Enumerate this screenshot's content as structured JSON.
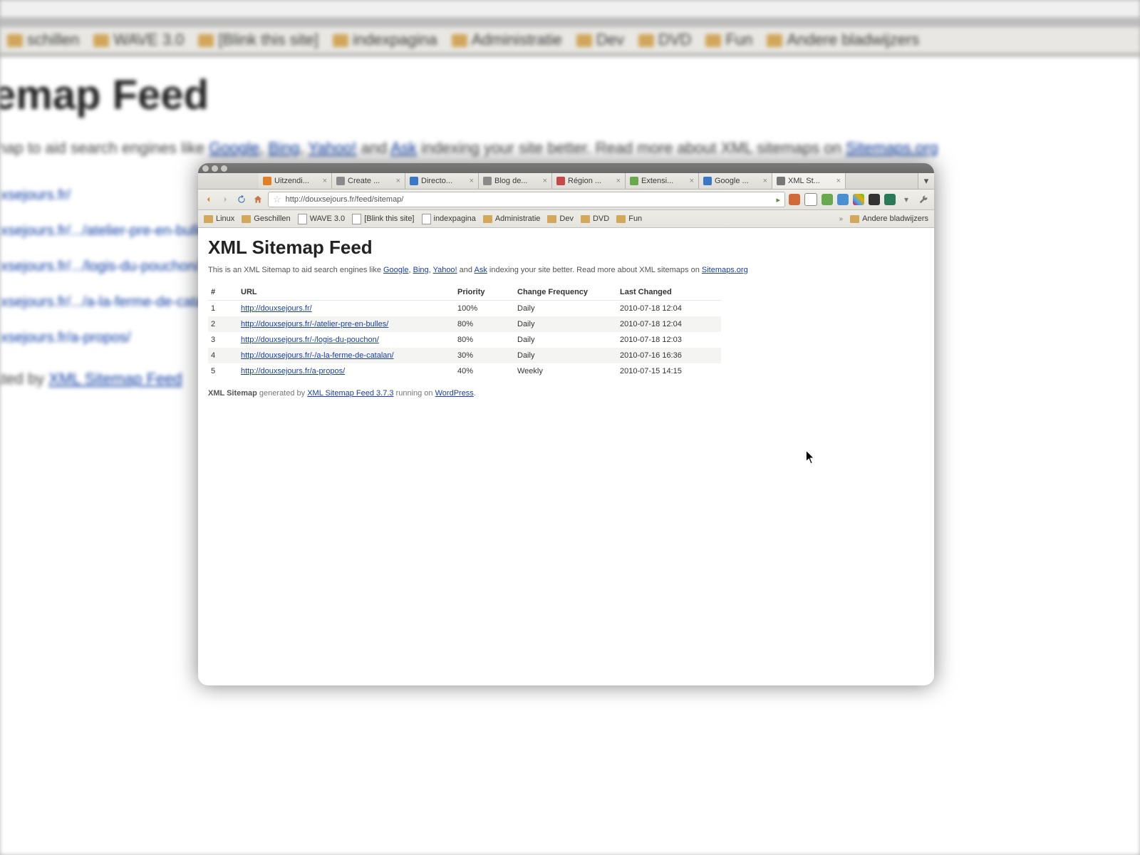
{
  "backdrop": {
    "title": "emap Feed",
    "bookmarks": [
      "schillen",
      "WAVE 3.0",
      "[Blink this site]",
      "indexpagina",
      "Administratie",
      "Dev",
      "DVD",
      "Fun",
      "Andere bladwijzers"
    ],
    "intro_pre": "map to aid search engines like ",
    "intro_links": [
      "Google",
      "Bing",
      "Yahoo!"
    ],
    "intro_and": " and ",
    "intro_ask": "Ask",
    "intro_post": " indexing your site better. Read more about XML sitemaps on ",
    "intro_end": "Sitemaps.org",
    "list": [
      "uxsejours.fr/",
      "uxsejours.fr/.../atelier-pre-en-bulles/",
      "uxsejours.fr/.../logis-du-pouchon/",
      "uxsejours.fr/.../a-la-ferme-de-catalan/",
      "uxsejours.fr/a-propos/"
    ],
    "gen_pre": "ated by ",
    "gen_link": "XML Sitemap Feed"
  },
  "tabs": [
    {
      "label": "Uitzendi...",
      "color": "#e07e2a"
    },
    {
      "label": "Create ...",
      "color": "#8a8a8a"
    },
    {
      "label": "Directo...",
      "color": "#3b78c4"
    },
    {
      "label": "Blog de...",
      "color": "#8a8a8a"
    },
    {
      "label": "Région ...",
      "color": "#c44a4a"
    },
    {
      "label": "Extensi...",
      "color": "#6aa84f"
    },
    {
      "label": "Google ...",
      "color": "#3b78c4"
    },
    {
      "label": "XML St...",
      "color": "#777",
      "active": true
    }
  ],
  "address": {
    "url": "http://douxsejours.fr/feed/sitemap/"
  },
  "bookmarks": [
    {
      "label": "Linux",
      "type": "folder"
    },
    {
      "label": "Geschillen",
      "type": "folder"
    },
    {
      "label": "WAVE 3.0",
      "type": "page"
    },
    {
      "label": "[Blink this site]",
      "type": "page"
    },
    {
      "label": "indexpagina",
      "type": "page"
    },
    {
      "label": "Administratie",
      "type": "folder"
    },
    {
      "label": "Dev",
      "type": "folder"
    },
    {
      "label": "DVD",
      "type": "folder"
    },
    {
      "label": "Fun",
      "type": "folder"
    }
  ],
  "bookmarks_overflow": "Andere bladwijzers",
  "page": {
    "title": "XML Sitemap Feed",
    "intro_pre": "This is an XML Sitemap to aid search engines like ",
    "links": {
      "google": "Google",
      "bing": "Bing",
      "yahoo": "Yahoo!",
      "ask": "Ask",
      "sitemaps": "Sitemaps.org"
    },
    "intro_and": " and ",
    "intro_mid": " indexing your site better. Read more about XML sitemaps on ",
    "headers": {
      "num": "#",
      "url": "URL",
      "priority": "Priority",
      "freq": "Change Frequency",
      "changed": "Last Changed"
    },
    "rows": [
      {
        "n": "1",
        "url": "http://douxsejours.fr/",
        "priority": "100%",
        "freq": "Daily",
        "changed": "2010-07-18 12:04"
      },
      {
        "n": "2",
        "url": "http://douxsejours.fr/-/atelier-pre-en-bulles/",
        "priority": "80%",
        "freq": "Daily",
        "changed": "2010-07-18 12:04"
      },
      {
        "n": "3",
        "url": "http://douxsejours.fr/-/logis-du-pouchon/",
        "priority": "80%",
        "freq": "Daily",
        "changed": "2010-07-18 12:03"
      },
      {
        "n": "4",
        "url": "http://douxsejours.fr/-/a-la-ferme-de-catalan/",
        "priority": "30%",
        "freq": "Daily",
        "changed": "2010-07-16 16:36"
      },
      {
        "n": "5",
        "url": "http://douxsejours.fr/a-propos/",
        "priority": "40%",
        "freq": "Weekly",
        "changed": "2010-07-15 14:15"
      }
    ],
    "footer_strong": "XML Sitemap",
    "footer_gen": " generated by ",
    "footer_plugin": "XML Sitemap Feed 3.7.3",
    "footer_run": " running on ",
    "footer_wp": "WordPress",
    "footer_dot": "."
  }
}
